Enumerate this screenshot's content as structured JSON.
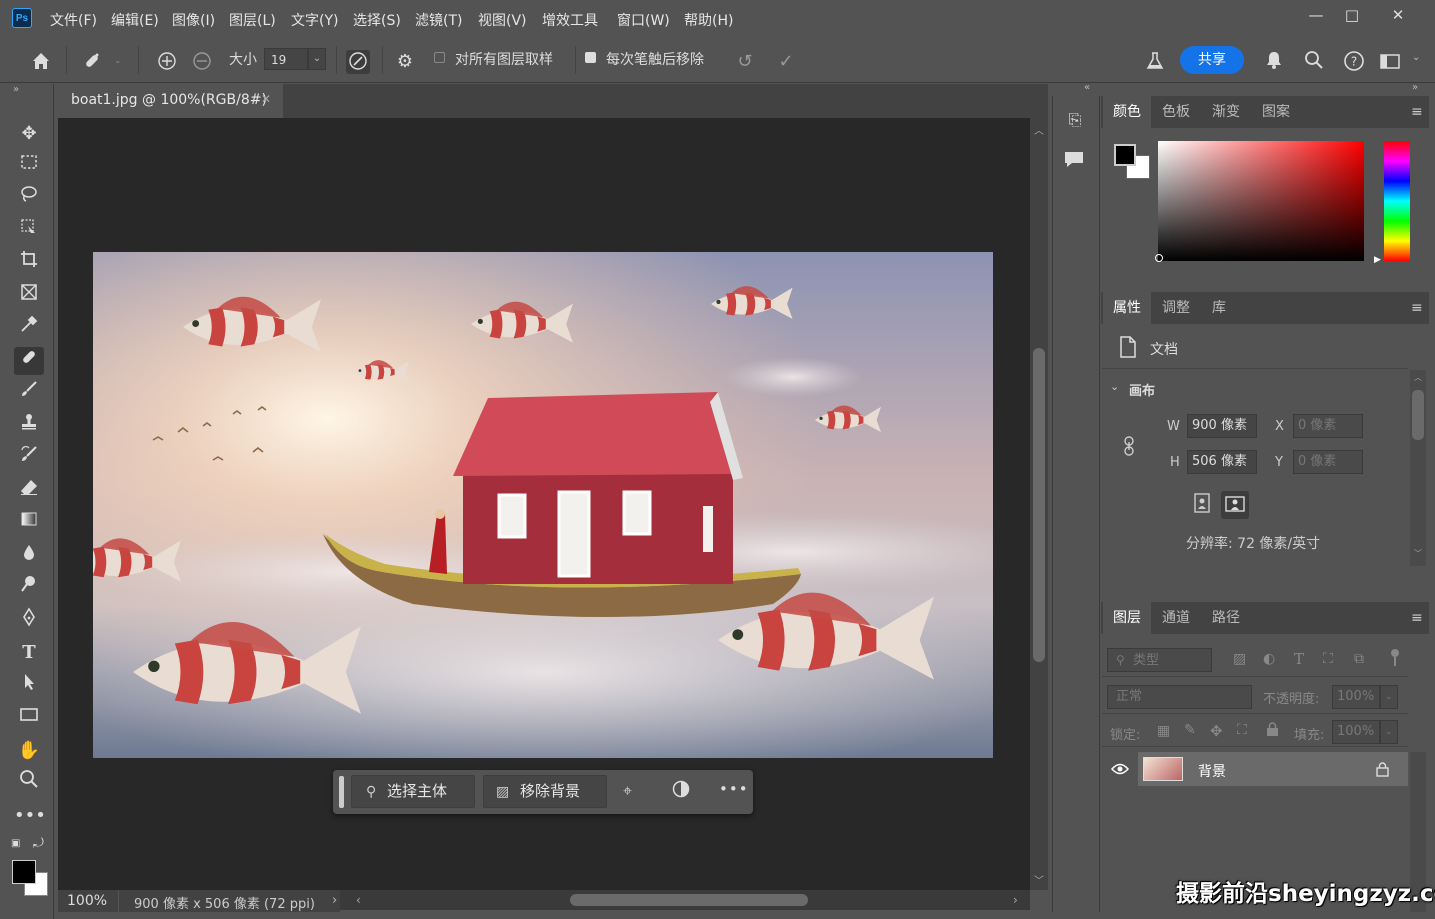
{
  "app": {
    "logo": "Ps"
  },
  "menubar": {
    "items": [
      "文件(F)",
      "编辑(E)",
      "图像(I)",
      "图层(L)",
      "文字(Y)",
      "选择(S)",
      "滤镜(T)",
      "视图(V)",
      "增效工具",
      "窗口(W)",
      "帮助(H)"
    ]
  },
  "window": {
    "minimize": "—",
    "restore": "□",
    "close": "✕"
  },
  "optionsbar": {
    "size_label": "大小",
    "size_value": "19",
    "sample_all_label": "对所有图层取样",
    "sample_all_checked": false,
    "remove_after_stroke_label": "每次笔触后移除",
    "remove_after_stroke_checked": true,
    "share_label": "共享"
  },
  "document": {
    "tab_title": "boat1.jpg @ 100%(RGB/8#)",
    "zoom": "100%",
    "status": "900 像素 x 506 像素 (72 ppi)"
  },
  "taskbar": {
    "select_subject": "选择主体",
    "remove_background": "移除背景"
  },
  "color_panel": {
    "tabs": [
      "颜色",
      "色板",
      "渐变",
      "图案"
    ],
    "foreground": "#000000",
    "background": "#ffffff"
  },
  "properties_panel": {
    "tabs": [
      "属性",
      "调整",
      "库"
    ],
    "doc_label": "文档",
    "canvas_section": "画布",
    "w_label": "W",
    "w_value": "900 像素",
    "h_label": "H",
    "h_value": "506 像素",
    "x_label": "X",
    "x_placeholder": "0 像素",
    "y_label": "Y",
    "y_placeholder": "0 像素",
    "resolution": "分辨率: 72 像素/英寸"
  },
  "layers_panel": {
    "tabs": [
      "图层",
      "通道",
      "路径"
    ],
    "filter_placeholder": "类型",
    "blend_mode": "正常",
    "opacity_label": "不透明度:",
    "opacity_value": "100%",
    "lock_label": "锁定:",
    "fill_label": "填充:",
    "fill_value": "100%",
    "layers": [
      {
        "name": "背景",
        "visible": true,
        "locked": true
      }
    ]
  },
  "watermark": "摄影前沿sheyingzyz.com",
  "colors": {
    "accent": "#1473e6",
    "panel_bg": "#535353",
    "canvas_bg": "#282828"
  }
}
